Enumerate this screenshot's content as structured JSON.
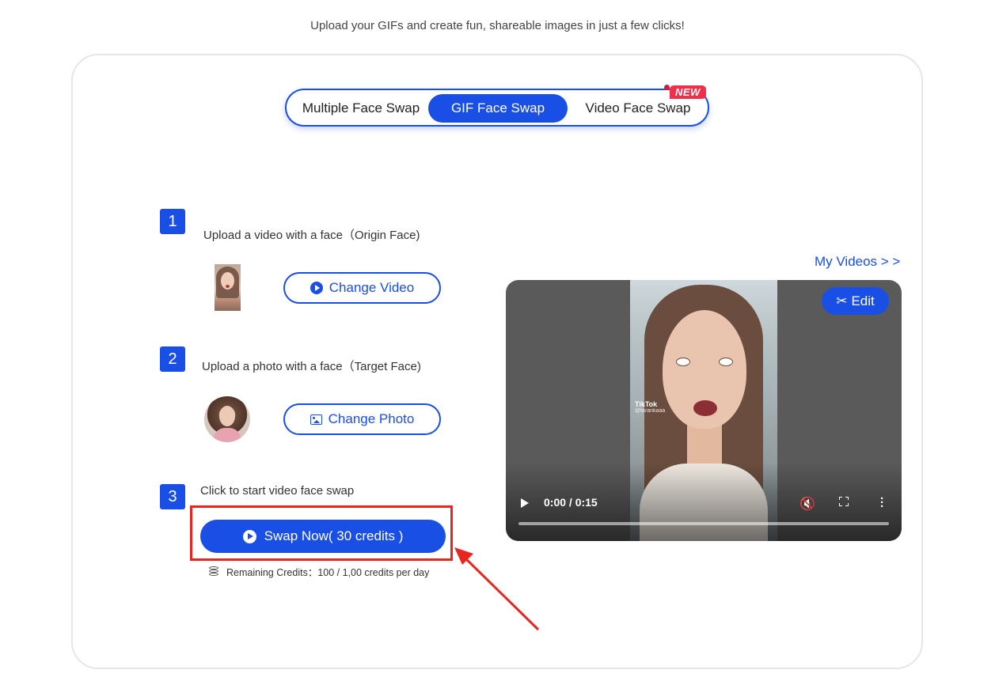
{
  "header": {
    "subtitle": "Upload your GIFs and create fun, shareable images in just a few clicks!"
  },
  "tabs": [
    {
      "label": "Multiple Face Swap",
      "active": false
    },
    {
      "label": "GIF Face Swap",
      "active": true
    },
    {
      "label": "Video Face Swap",
      "active": false,
      "badge": "NEW"
    }
  ],
  "steps": [
    {
      "number": "1",
      "label": "Upload a video with a face（Origin Face)",
      "button": "Change Video",
      "button_icon": "play-circle-icon"
    },
    {
      "number": "2",
      "label": "Upload a photo with a face（Target Face)",
      "button": "Change Photo",
      "button_icon": "image-icon"
    },
    {
      "number": "3",
      "label": "Click to start video face swap"
    }
  ],
  "swap": {
    "button": "Swap Now( 30 credits )",
    "credits_text": "Remaining Credits：100 / 1,00 credits per day"
  },
  "player": {
    "my_videos_link": "My Videos > >",
    "edit_label": "Edit",
    "time": "0:00 / 0:15",
    "progress": 0,
    "watermark_brand": "TikTok",
    "watermark_user": "@tarankaaa"
  },
  "colors": {
    "accent": "#1a4fe6",
    "badge": "#f0304a",
    "highlight_box": "#e8261f"
  }
}
